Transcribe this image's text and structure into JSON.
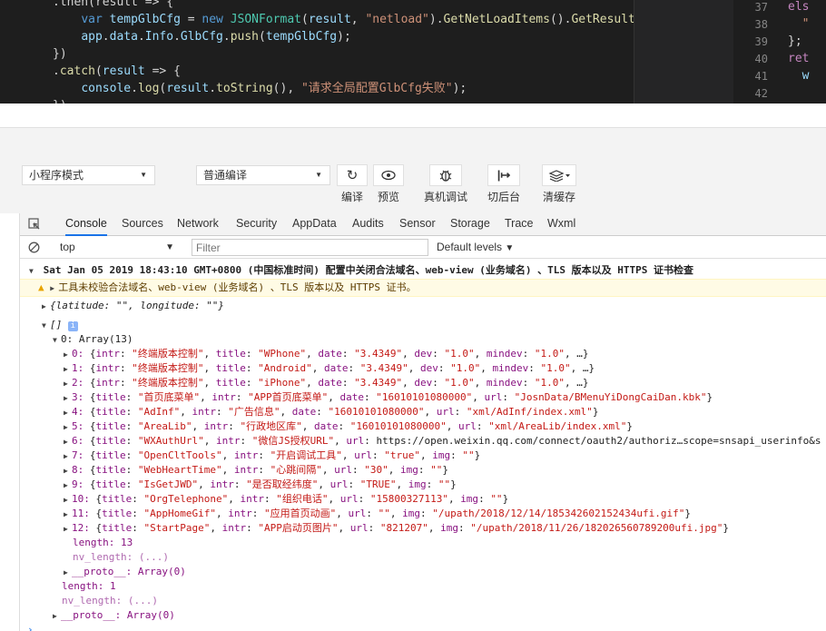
{
  "editor": {
    "lines": [
      {
        "ind": "",
        "toks": [
          [
            "pun",
            ".then(result => {"
          ]
        ]
      },
      {
        "ind": "    ",
        "toks": [
          [
            "kw",
            "var "
          ],
          [
            "var",
            "tempGlbCfg"
          ],
          [
            "pun",
            " = "
          ],
          [
            "kw",
            "new "
          ],
          [
            "cls",
            "JSONFormat"
          ],
          [
            "pun",
            "("
          ],
          [
            "var",
            "result"
          ],
          [
            "pun",
            ", "
          ],
          [
            "str",
            "\"netload\""
          ],
          [
            "pun",
            ")."
          ],
          [
            "fn",
            "GetNetLoadItems"
          ],
          [
            "pun",
            "()."
          ],
          [
            "fn",
            "GetResults"
          ],
          [
            "pun",
            "("
          ]
        ]
      },
      {
        "ind": "    ",
        "toks": [
          [
            "var",
            "app"
          ],
          [
            "pun",
            "."
          ],
          [
            "var",
            "data"
          ],
          [
            "pun",
            "."
          ],
          [
            "var",
            "Info"
          ],
          [
            "pun",
            "."
          ],
          [
            "var",
            "GlbCfg"
          ],
          [
            "pun",
            "."
          ],
          [
            "fn",
            "push"
          ],
          [
            "pun",
            "("
          ],
          [
            "var",
            "tempGlbCfg"
          ],
          [
            "pun",
            ");"
          ]
        ]
      },
      {
        "ind": "",
        "toks": [
          [
            "pun",
            "})"
          ]
        ]
      },
      {
        "ind": "",
        "toks": [
          [
            "pun",
            "."
          ],
          [
            "fn",
            "catch"
          ],
          [
            "pun",
            "("
          ],
          [
            "var",
            "result"
          ],
          [
            "pun",
            " => {"
          ]
        ]
      },
      {
        "ind": "    ",
        "toks": [
          [
            "var",
            "console"
          ],
          [
            "pun",
            "."
          ],
          [
            "fn",
            "log"
          ],
          [
            "pun",
            "("
          ],
          [
            "var",
            "result"
          ],
          [
            "pun",
            "."
          ],
          [
            "fn",
            "toString"
          ],
          [
            "pun",
            "(), "
          ],
          [
            "str",
            "\"请求全局配置GlbCfg失败\""
          ],
          [
            "pun",
            ");"
          ]
        ]
      },
      {
        "ind": "",
        "toks": [
          [
            "pun",
            "})"
          ]
        ]
      }
    ],
    "right_line_numbers": [
      "37",
      "38",
      "39",
      "40",
      "41",
      "42"
    ],
    "right_code": [
      "els",
      "  \"",
      "};",
      "ret",
      "  w",
      ""
    ]
  },
  "toolbar": {
    "mode_select": "小程序模式",
    "compile_select": "普通编译",
    "buttons": [
      {
        "label": "编译",
        "icon": "refresh-icon"
      },
      {
        "label": "预览",
        "icon": "eye-icon"
      },
      {
        "label": "真机调试",
        "icon": "bug-icon"
      },
      {
        "label": "切后台",
        "icon": "switch-icon"
      },
      {
        "label": "清缓存",
        "icon": "layers-icon"
      }
    ]
  },
  "devtools": {
    "tabs": [
      "Console",
      "Sources",
      "Network",
      "Security",
      "AppData",
      "Audits",
      "Sensor",
      "Storage",
      "Trace",
      "Wxml"
    ],
    "active_tab": "Console"
  },
  "filter": {
    "context": "top",
    "placeholder": "Filter",
    "levels": "Default levels"
  },
  "console": {
    "group_header": "Sat Jan 05 2019 18:43:10 GMT+0800 (中国标准时间) 配置中关闭合法域名、web-view (业务域名) 、TLS 版本以及 HTTPS 证书检查",
    "warning": "工具未校验合法域名、web-view (业务域名) 、TLS 版本以及 HTTPS 证书。",
    "location_obj": "{latitude: \"\", longitude: \"\"}",
    "array_label": "[]",
    "array0_label": "0: Array(13)",
    "items": [
      "0: {intr: \"终端版本控制\", title: \"WPhone\", date: \"3.4349\", dev: \"1.0\", mindev: \"1.0\", …}",
      "1: {intr: \"终端版本控制\", title: \"Android\", date: \"3.4349\", dev: \"1.0\", mindev: \"1.0\", …}",
      "2: {intr: \"终端版本控制\", title: \"iPhone\", date: \"3.4349\", dev: \"1.0\", mindev: \"1.0\", …}",
      "3: {title: \"首页底菜单\", intr: \"APP首页底菜单\", date: \"16010101080000\", url: \"JosnData/BMenuYiDongCaiDan.kbk\"}",
      "4: {title: \"AdInf\", intr: \"广告信息\", date: \"16010101080000\", url: \"xml/AdInf/index.xml\"}",
      "5: {title: \"AreaLib\", intr: \"行政地区库\", date: \"16010101080000\", url: \"xml/AreaLib/index.xml\"}",
      "6: {title: \"WXAuthUrl\", intr: \"微信JS授权URL\", url: \"https://open.weixin.qq.com/connect/oauth2/authoriz…scope=snsapi_userinfo&s",
      "7: {title: \"OpenCltTools\", intr: \"开启调试工具\", url: \"true\", img: \"\"}",
      "8: {title: \"WebHeartTime\", intr: \"心跳间隔\", url: \"30\", img: \"\"}",
      "9: {title: \"IsGetJWD\", intr: \"是否取经纬度\", url: \"TRUE\", img: \"\"}",
      "10: {title: \"OrgTelephone\", intr: \"组织电话\", url: \"15800327113\", img: \"\"}",
      "11: {title: \"AppHomeGif\", intr: \"应用首页动画\", url: \"\", img: \"/upath/2018/12/14/185342602152434ufi.gif\"}",
      "12: {title: \"StartPage\", intr: \"APP启动页图片\", url: \"821207\", img: \"/upath/2018/11/26/182026560789200ufi.jpg\"}"
    ],
    "inner_length": "length: 13",
    "inner_nv_length": "nv_length: (...)",
    "inner_proto": "__proto__: Array(0)",
    "outer_length": "length: 1",
    "outer_nv_length": "nv_length: (...)",
    "outer_proto": "__proto__: Array(0)"
  },
  "colors": {
    "warning_bg": "#fffbe5",
    "accent": "#1a73e8"
  }
}
